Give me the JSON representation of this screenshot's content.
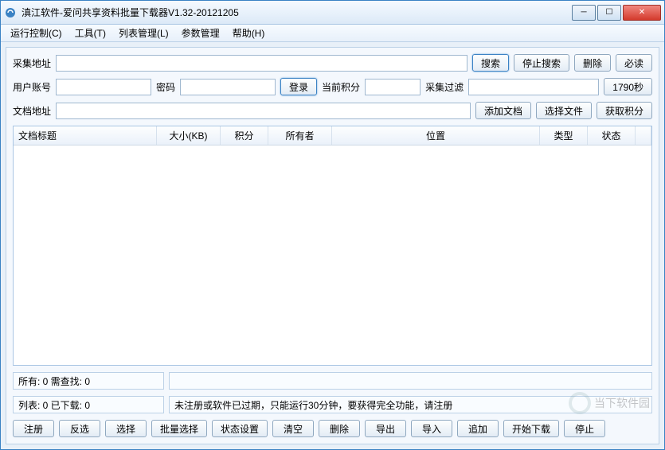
{
  "window": {
    "title": "滇江软件-爱问共享资料批量下载器V1.32-20121205"
  },
  "menu": {
    "items": [
      "运行控制(C)",
      "工具(T)",
      "列表管理(L)",
      "参数管理",
      "帮助(H)"
    ]
  },
  "row1": {
    "label_addr": "采集地址",
    "btn_search": "搜索",
    "btn_stop_search": "停止搜索",
    "btn_delete": "删除",
    "btn_must_read": "必读"
  },
  "row2": {
    "label_user": "用户账号",
    "label_pass": "密码",
    "btn_login": "登录",
    "label_points": "当前积分",
    "label_filter": "采集过滤",
    "seconds": "1790秒"
  },
  "row3": {
    "label_doc": "文档地址",
    "btn_add_doc": "添加文档",
    "btn_choose_file": "选择文件",
    "btn_get_points": "获取积分"
  },
  "table": {
    "headers": [
      "文档标题",
      "大小(KB)",
      "积分",
      "所有者",
      "位置",
      "类型",
      "状态"
    ]
  },
  "info": {
    "box1": "所有: 0 需查找: 0",
    "box2_label": "列表: 0 已下载: 0",
    "box2_msg": "未注册或软件已过期，只能运行30分钟，要获得完全功能，请注册"
  },
  "buttons": {
    "register": "注册",
    "invert": "反选",
    "select": "选择",
    "batch_select": "批量选择",
    "state_set": "状态设置",
    "clear": "清空",
    "delete": "删除",
    "export": "导出",
    "import": "导入",
    "append": "追加",
    "start_dl": "开始下载",
    "stop": "停止"
  },
  "watermark": "当下软件园"
}
